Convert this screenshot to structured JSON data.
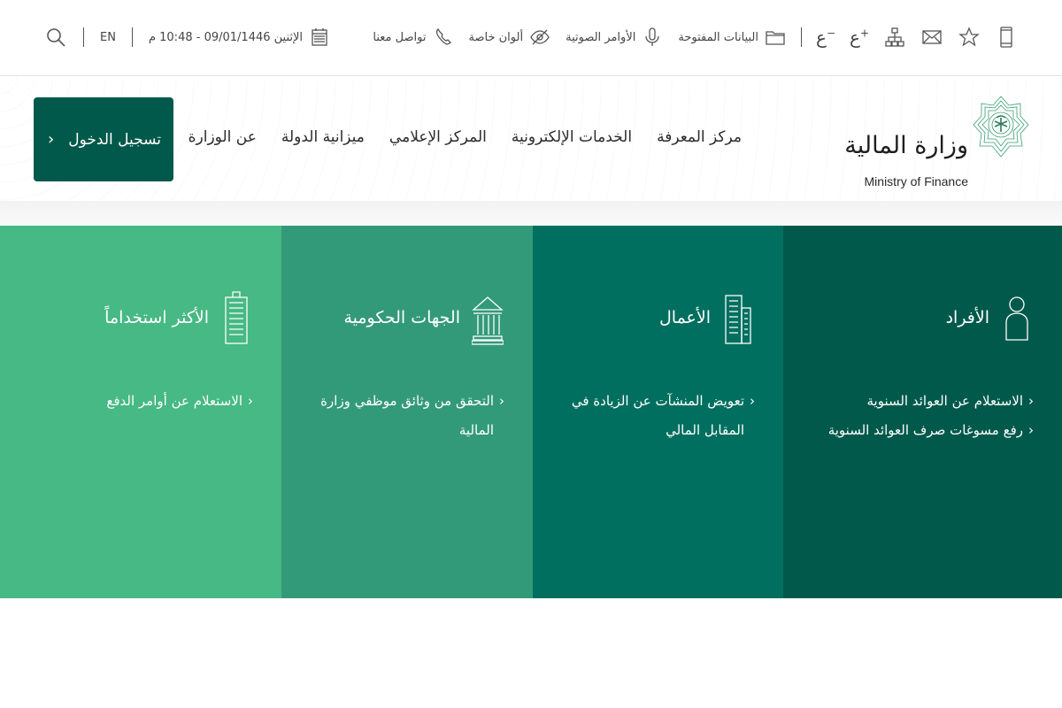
{
  "topbar": {
    "search_icon": "search-icon",
    "lang": "EN",
    "datetime": "الإثنين 09/01/1446 - 10:48 م",
    "calendar_icon": "calendar-icon",
    "contact_label": "تواصل معنا",
    "contact_icon": "phone-icon",
    "colors_label": "ألوان خاصة",
    "colors_icon": "eye-slash-icon",
    "voice_label": "الأوامر الصوتية",
    "voice_icon": "microphone-icon",
    "opendata_label": "البيانات المفتوحة",
    "opendata_icon": "folder-icon",
    "font_decrease": "ع",
    "font_increase": "ع",
    "sitemap_icon": "sitemap-icon",
    "mail_icon": "mail-icon",
    "star_icon": "star-icon",
    "mobile_icon": "mobile-icon"
  },
  "header": {
    "logo_ar": "وزارة المالية",
    "logo_en": "Ministry of Finance",
    "nav": [
      "عن الوزارة",
      "ميزانية الدولة",
      "المركز الإعلامي",
      "الخدمات الإلكترونية",
      "مركز المعرفة"
    ],
    "login_label": "تسجيل الدخول",
    "login_chevron": "›"
  },
  "panels": [
    {
      "title": "الأفراد",
      "icon": "person-icon",
      "color": "#00594a",
      "links": [
        "الاستعلام عن العوائد السنوية",
        "رفع مسوغات صرف العوائد السنوية"
      ]
    },
    {
      "title": "الأعمال",
      "icon": "building-icon",
      "color": "#006f5f",
      "links": [
        "تعويض المنشآت عن الزيادة في المقابل المالي"
      ]
    },
    {
      "title": "الجهات الحكومية",
      "icon": "government-building-icon",
      "color": "#339a79",
      "links": [
        "التحقق من وثائق موظفي وزارة المالية"
      ]
    },
    {
      "title": "الأكثر استخداماً",
      "icon": "tower-icon",
      "color": "#46b984",
      "links": [
        "الاستعلام عن أوامر الدفع"
      ]
    }
  ],
  "link_chevron": "‹"
}
